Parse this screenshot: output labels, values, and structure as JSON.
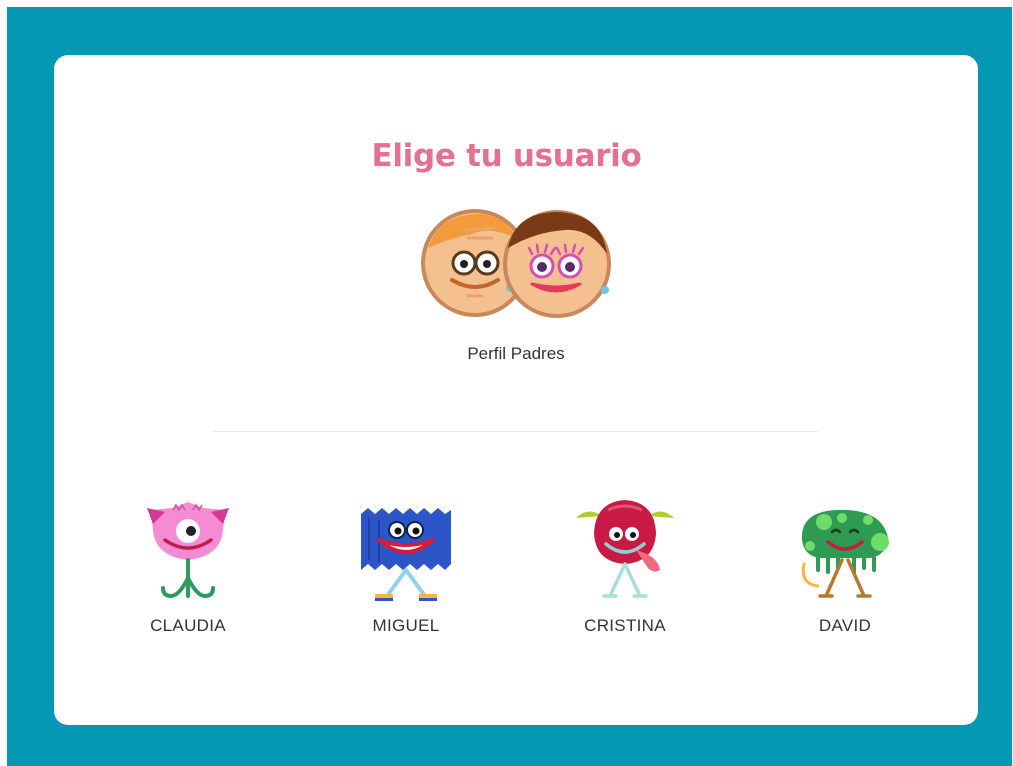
{
  "header": {
    "title": "Elige tu usuario"
  },
  "parent_profile": {
    "label": "Perfil Padres",
    "icon": "parents-faces-icon"
  },
  "users": [
    {
      "name": "CLAUDIA",
      "icon": "pink-monster-icon"
    },
    {
      "name": "MIGUEL",
      "icon": "blue-monster-icon"
    },
    {
      "name": "CRISTINA",
      "icon": "red-monster-icon"
    },
    {
      "name": "DAVID",
      "icon": "green-monster-icon"
    }
  ],
  "colors": {
    "frame": "#0598b5",
    "card": "#ffffff",
    "title": "#e2728f",
    "text": "#333333"
  }
}
